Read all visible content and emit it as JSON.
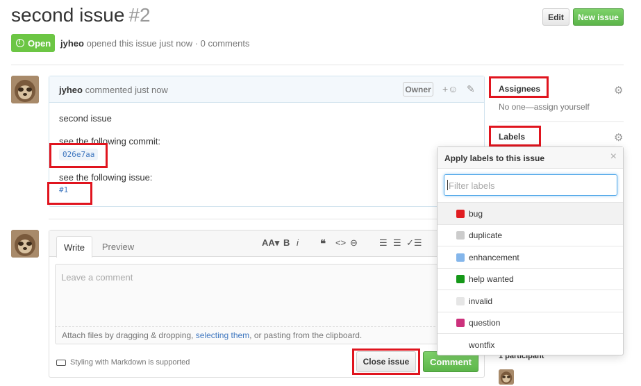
{
  "header": {
    "title": "second issue",
    "number": "#2",
    "edit_label": "Edit",
    "new_issue_label": "New issue",
    "state": "Open",
    "author": "jyheo",
    "meta_text": "opened this issue just now · 0 comments"
  },
  "comment": {
    "author": "jyheo",
    "time_text": "commented just now",
    "owner_badge": "Owner",
    "line1": "second issue",
    "line2": "see the following commit:",
    "commit": "026e7aa",
    "line3": "see the following issue:",
    "issue_ref": "#1"
  },
  "editor": {
    "tab_write": "Write",
    "tab_preview": "Preview",
    "placeholder": "Leave a comment",
    "attach_pre": "Attach files by dragging & dropping, ",
    "attach_link": "selecting them",
    "attach_post": ", or pasting from the clipboard.",
    "markdown_note": "Styling with Markdown is supported",
    "close_label": "Close issue",
    "comment_label": "Comment"
  },
  "sidebar": {
    "assignees_label": "Assignees",
    "assignees_value": "No one—assign yourself",
    "labels_label": "Labels",
    "participants": "1 participant"
  },
  "label_popover": {
    "title": "Apply labels to this issue",
    "filter_placeholder": "Filter labels",
    "labels": [
      {
        "name": "bug",
        "color": "#e11d21"
      },
      {
        "name": "duplicate",
        "color": "#cccccc"
      },
      {
        "name": "enhancement",
        "color": "#84b6eb"
      },
      {
        "name": "help wanted",
        "color": "#159818"
      },
      {
        "name": "invalid",
        "color": "#e6e6e6"
      },
      {
        "name": "question",
        "color": "#cc317c"
      },
      {
        "name": "wontfix",
        "color": "#ffffff"
      }
    ]
  }
}
